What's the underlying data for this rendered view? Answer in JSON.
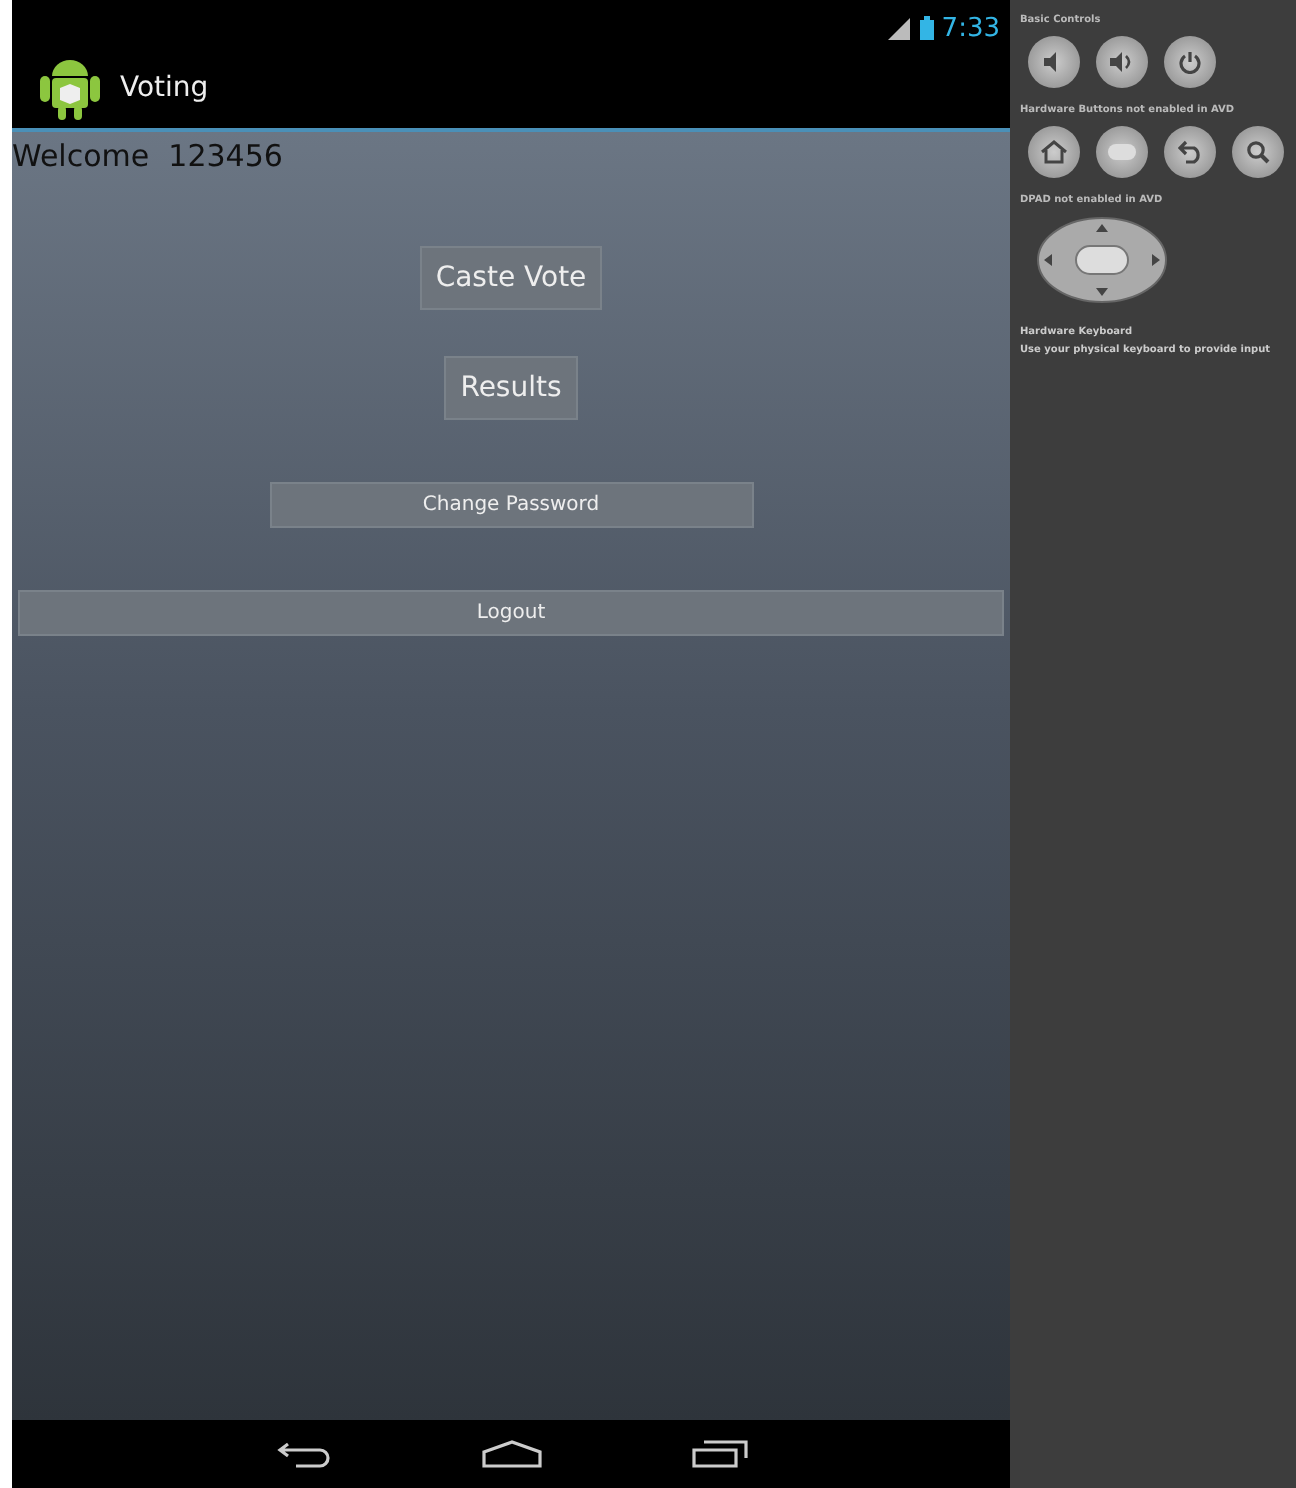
{
  "status_bar": {
    "time": "7:33"
  },
  "action_bar": {
    "title": "Voting"
  },
  "welcome": "Welcome  123456",
  "buttons": [
    {
      "label": "Caste Vote",
      "kind": "wrap"
    },
    {
      "label": "Results",
      "kind": "wrap"
    },
    {
      "label": "Change Password",
      "kind": "medium"
    },
    {
      "label": "Logout",
      "kind": "full"
    }
  ],
  "controls_panel": {
    "basic_title": "Basic Controls",
    "hardware_title": "Hardware Buttons not enabled in AVD",
    "dpad_title": "DPAD not enabled in AVD",
    "keyboard_title": "Hardware Keyboard",
    "keyboard_hint": "Use your physical keyboard to provide input"
  }
}
